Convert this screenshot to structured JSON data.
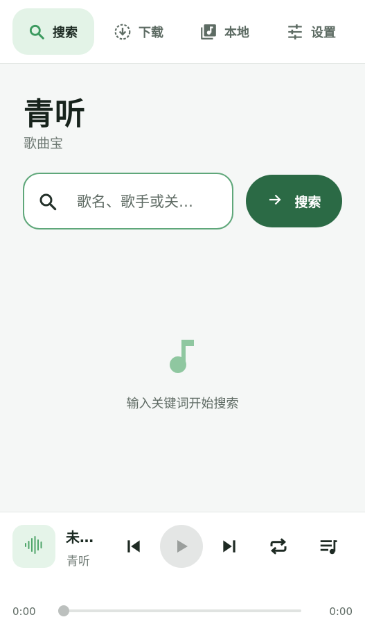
{
  "nav": {
    "items": [
      {
        "label": "搜索",
        "icon": "search-icon",
        "active": true
      },
      {
        "label": "下载",
        "icon": "download-icon",
        "active": false
      },
      {
        "label": "本地",
        "icon": "library-music-icon",
        "active": false
      },
      {
        "label": "设置",
        "icon": "tune-icon",
        "active": false
      }
    ]
  },
  "header": {
    "title": "青听",
    "subtitle": "歌曲宝"
  },
  "search": {
    "placeholder": "歌名、歌手或关…",
    "value": "",
    "button_label": "搜索"
  },
  "empty_state": {
    "icon": "music-note-icon",
    "message": "输入关键词开始搜索"
  },
  "player": {
    "title": "未…",
    "artist": "青听",
    "cover_icon": "waveform-icon",
    "current_time": "0:00",
    "total_time": "0:00",
    "progress": 0
  },
  "colors": {
    "accent": "#2b6a45",
    "accent_light": "#e3f3e7",
    "icon_green": "#4fa56a",
    "background": "#f5f7f6"
  }
}
